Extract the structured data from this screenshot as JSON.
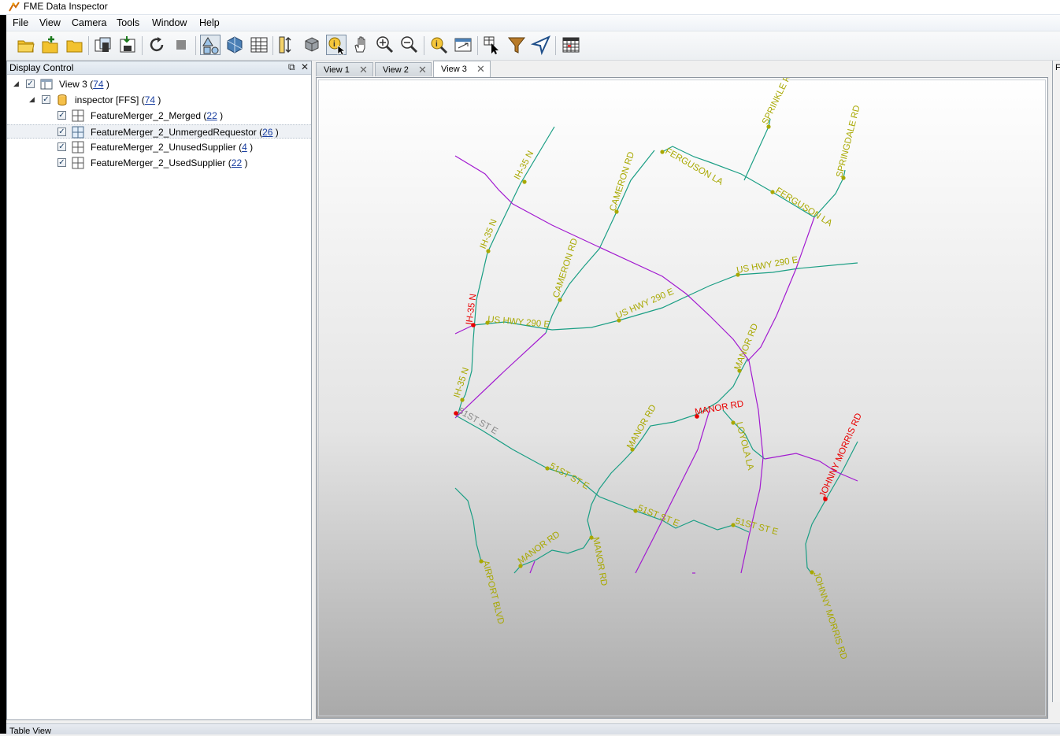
{
  "window": {
    "title": "FME Data Inspector"
  },
  "menu": [
    "File",
    "View",
    "Camera",
    "Tools",
    "Window",
    "Help"
  ],
  "toolbar_icons": [
    "open-folder-icon",
    "add-dataset-icon",
    "folder-icon",
    "copy-view-icon",
    "save-icon",
    "refresh-icon",
    "stop-icon",
    "geometry-view-icon",
    "3d-view-icon",
    "table-grid-icon",
    "measure-icon",
    "3d-box-icon",
    "inspect-info-icon",
    "pan-hand-icon",
    "zoom-in-icon",
    "zoom-out-icon",
    "find-icon",
    "zoom-extent-icon",
    "select-features-icon",
    "filter-icon",
    "navigate-arrow-icon",
    "table-view-icon"
  ],
  "display_control": {
    "title": "Display Control",
    "tree": [
      {
        "label": "View 3 (",
        "count": "74",
        "suffix": " )",
        "level": 0,
        "type": "view",
        "checked": true
      },
      {
        "label": "inspector [FFS] (",
        "count": "74",
        "suffix": " )",
        "level": 1,
        "type": "dataset",
        "checked": true
      },
      {
        "label": "FeatureMerger_2_Merged (",
        "count": "22",
        "suffix": " )",
        "level": 2,
        "type": "featuretype",
        "checked": true,
        "selected": false
      },
      {
        "label": "FeatureMerger_2_UnmergedRequestor (",
        "count": "26",
        "suffix": " )",
        "level": 2,
        "type": "featuretype",
        "checked": true,
        "selected": true
      },
      {
        "label": "FeatureMerger_2_UnusedSupplier (",
        "count": "4",
        "suffix": " )",
        "level": 2,
        "type": "featuretype",
        "checked": true,
        "selected": false
      },
      {
        "label": "FeatureMerger_2_UsedSupplier (",
        "count": "22",
        "suffix": " )",
        "level": 2,
        "type": "featuretype",
        "checked": true,
        "selected": false
      }
    ]
  },
  "tabs": [
    {
      "label": "View 1",
      "active": false
    },
    {
      "label": "View 2",
      "active": false
    },
    {
      "label": "View 3",
      "active": true
    }
  ],
  "map": {
    "colors": {
      "green": "#1a9e84",
      "purple": "#a21ad0",
      "label": "#a8a800",
      "red": "#e80000"
    },
    "labels": [
      "IH-35 N",
      "IH-35 N",
      "IH-35 N",
      "IH-35 N",
      "CAMERON RD",
      "CAMERON RD",
      "FERGUSON LA",
      "FERGUSON LA",
      "SPRINKLE RD",
      "SPRINGDALE RD",
      "US HWY 290 E",
      "US HWY 290 E",
      "US HWY 290 E",
      "MANOR RD",
      "MANOR RD",
      "MANOR RD",
      "MANOR RD",
      "MANOR RD",
      "LOYOLA LA",
      "51ST ST E",
      "51ST ST E",
      "51ST ST E",
      "51ST ST E",
      "JOHNNY MORRIS RD",
      "JOHNNY MORRIS RD",
      "AIRPORT BLVD"
    ]
  },
  "right_panel": {
    "header": "F"
  },
  "bottom": {
    "label": "Table View"
  }
}
